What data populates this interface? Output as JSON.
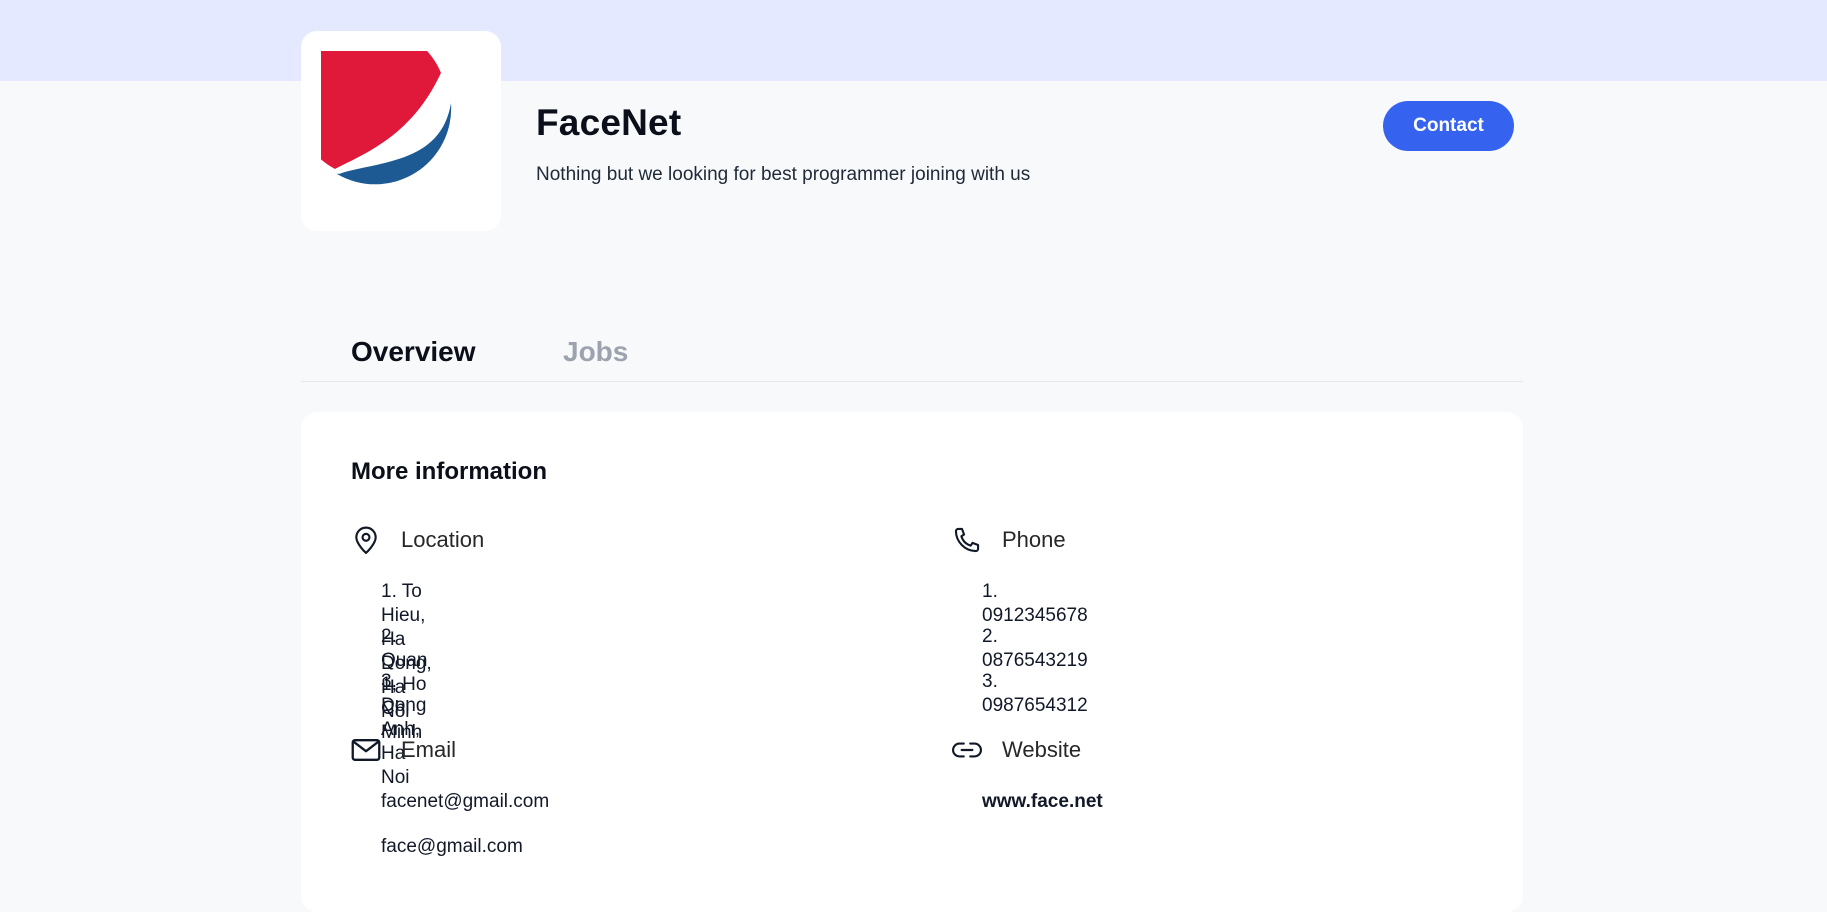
{
  "company": {
    "name": "FaceNet",
    "tagline": "Nothing but we looking for best programmer joining with us"
  },
  "header": {
    "contact_label": "Contact"
  },
  "tabs": [
    {
      "label": "Overview",
      "active": true
    },
    {
      "label": "Jobs",
      "active": false
    }
  ],
  "info": {
    "title": "More information",
    "location": {
      "label": "Location",
      "items": [
        "1. To Hieu, Ha Dong, Ha Noi",
        "2. Quan 1, Ho Chi Minh",
        "3. Dong Anh, Ha Noi"
      ]
    },
    "phone": {
      "label": "Phone",
      "items": [
        "1. 0912345678",
        "2. 0876543219",
        "3. 0987654312"
      ]
    },
    "email": {
      "label": "Email",
      "items": [
        "facenet@gmail.com",
        "face@gmail.com"
      ]
    },
    "website": {
      "label": "Website",
      "url": "www.face.net"
    }
  },
  "colors": {
    "accent": "#3563f0",
    "top_band": "#e4e9ff",
    "logo_red": "#e0183a",
    "logo_blue": "#1d5a94"
  },
  "icons": {
    "location": "map-pin-icon",
    "phone": "phone-icon",
    "email": "mail-icon",
    "website": "link-icon"
  }
}
